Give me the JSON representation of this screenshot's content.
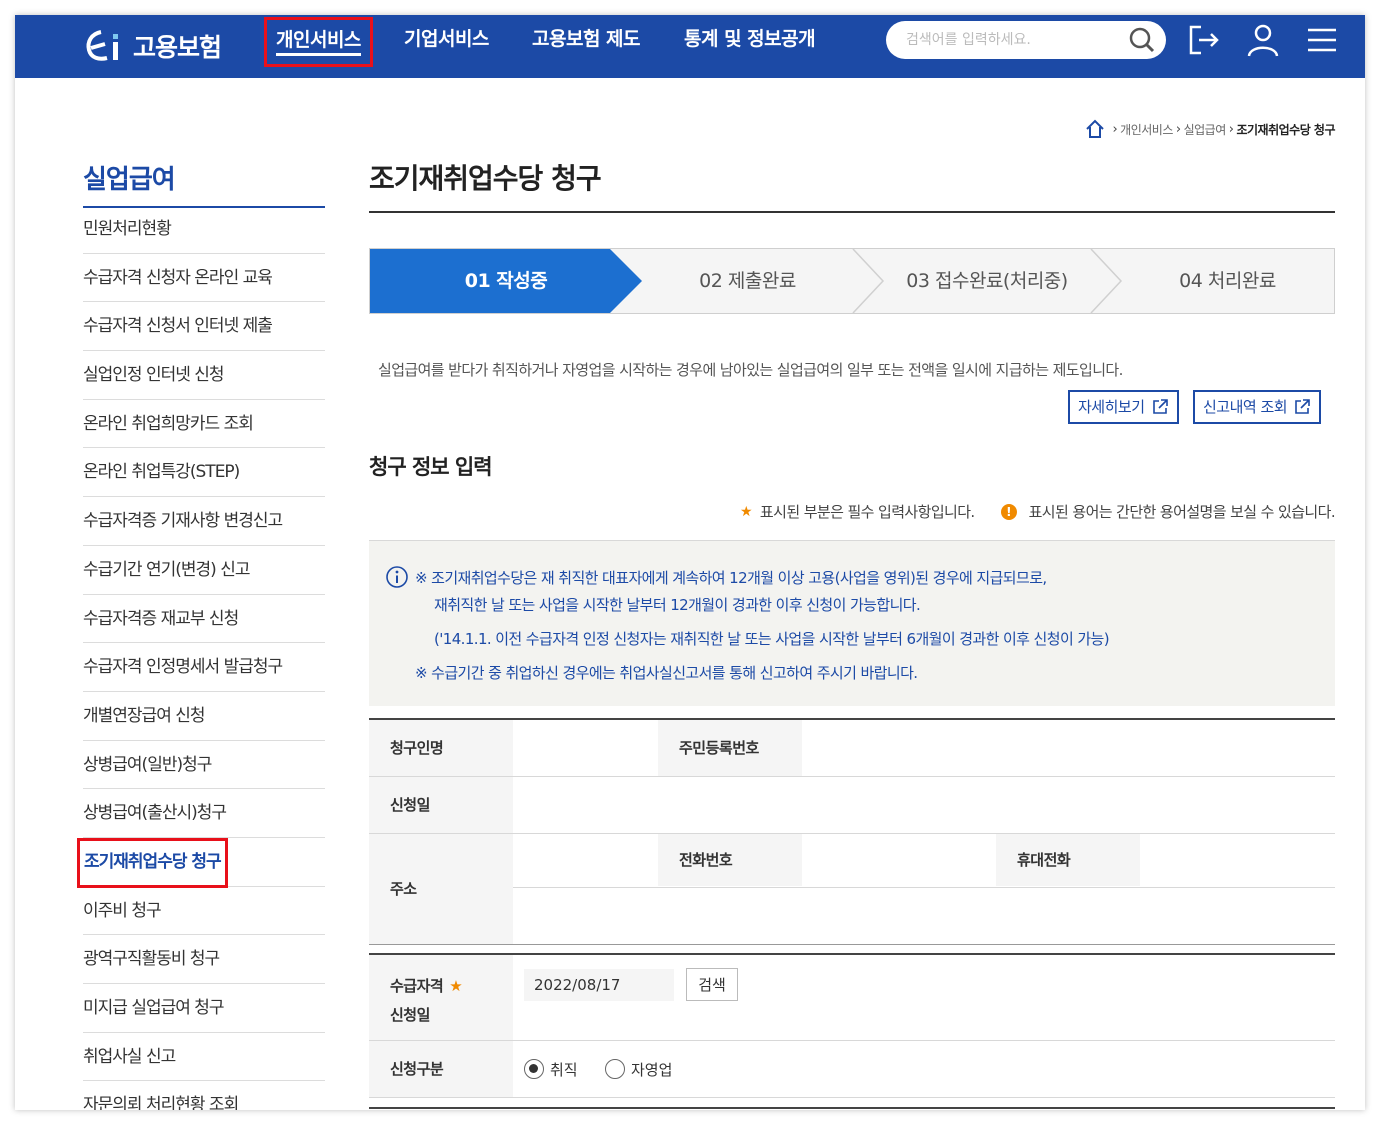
{
  "header": {
    "logo_text": "고용보험",
    "nav": [
      "개인서비스",
      "기업서비스",
      "고용보험 제도",
      "통계 및 정보공개"
    ],
    "search_placeholder": "검색어를 입력하세요.",
    "colors": {
      "brand": "#1c4aa6",
      "highlight_box": "#e8101a"
    }
  },
  "breadcrumb": [
    "개인서비스",
    "실업급여",
    "조기재취업수당 청구"
  ],
  "sidebar": {
    "title": "실업급여",
    "items": [
      "민원처리현황",
      "수급자격 신청자 온라인 교육",
      "수급자격 신청서 인터넷 제출",
      "실업인정 인터넷 신청",
      "온라인 취업희망카드 조회",
      "온라인 취업특강(STEP)",
      "수급자격증 기재사항 변경신고",
      "수급기간 연기(변경) 신고",
      "수급자격증 재교부 신청",
      "수급자격 인정명세서 발급청구",
      "개별연장급여 신청",
      "상병급여(일반)청구",
      "상병급여(출산시)청구",
      "조기재취업수당 청구",
      "이주비 청구",
      "광역구직활동비 청구",
      "미지급 실업급여 청구",
      "취업사실 신고",
      "자문의뢰 처리현황 조회"
    ],
    "active_index": 13
  },
  "main": {
    "title": "조기재취업수당 청구",
    "steps": [
      "01 작성중",
      "02 제출완료",
      "03 접수완료(처리중)",
      "04 처리완료"
    ],
    "active_step": 0,
    "description": "실업급여를 받다가 취직하거나 자영업을 시작하는 경우에 남아있는 실업급여의 일부 또는 전액을 일시에 지급하는 제도입니다.",
    "buttons": {
      "detail": "자세히보기",
      "history": "신고내역 조회"
    },
    "section_title": "청구 정보 입력",
    "legend": {
      "required": "표시된 부분은 필수 입력사항입니다.",
      "glossary": "표시된 용어는 간단한 용어설명을 보실 수 있습니다."
    },
    "notice": [
      "※ 조기재취업수당은 재 취직한 대표자에게 계속하여 12개월 이상 고용(사업을 영위)된 경우에 지급되므로,",
      "재취직한 날 또는 사업을 시작한 날부터 12개월이 경과한 이후 신청이 가능합니다.",
      "('14.1.1. 이전 수급자격 인정 신청자는 재취직한 날 또는 사업을 시작한 날부터 6개월이 경과한 이후 신청이 가능)",
      "※ 수급기간 중 취업하신 경우에는 취업사실신고서를 통해 신고하여 주시기 바랍니다."
    ],
    "form1": {
      "claimant_label": "청구인명",
      "rrn_label": "주민등록번호",
      "apply_date_label": "신청일",
      "address_label": "주소",
      "phone_label": "전화번호",
      "mobile_label": "휴대전화"
    },
    "form2": {
      "qual_date_label_1": "수급자격",
      "qual_date_label_2": "신청일",
      "qual_date_value": "2022/08/17",
      "search_button": "검색",
      "type_label": "신청구분",
      "type_options": [
        "취직",
        "자영업"
      ],
      "type_selected": 0
    }
  }
}
